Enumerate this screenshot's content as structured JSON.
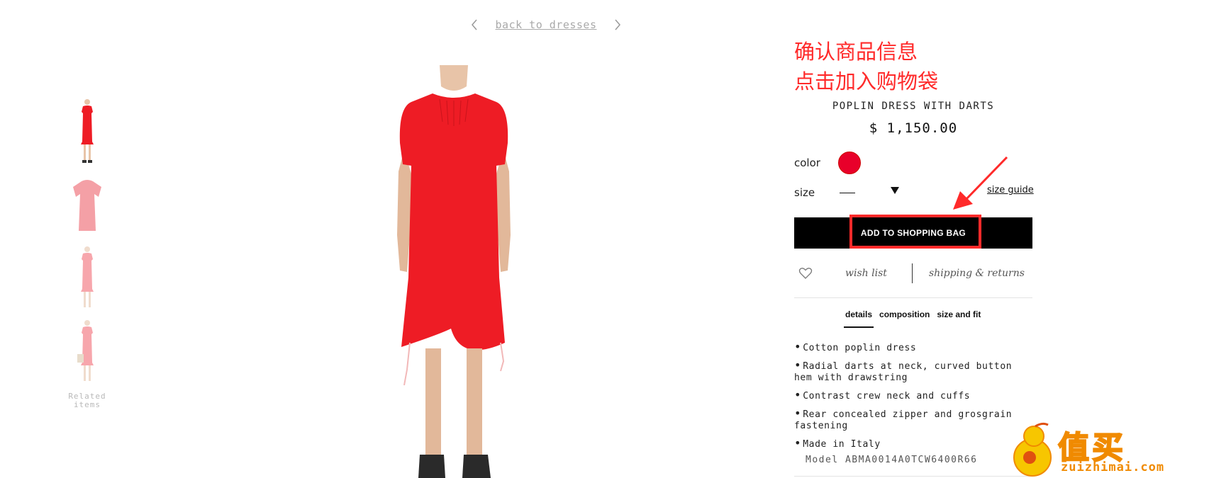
{
  "nav": {
    "back_label": "back to dresses",
    "prev_icon": "chevron-left-icon",
    "next_icon": "chevron-right-icon"
  },
  "gallery": {
    "thumbnails": [
      "front view",
      "flat view",
      "side view",
      "styled view"
    ],
    "related_label_line1": "Related",
    "related_label_line2": "items"
  },
  "annotation": {
    "line1": "确认商品信息",
    "line2": "点击加入购物袋",
    "color": "#ff2a2a"
  },
  "product": {
    "name": "POPLIN DRESS WITH DARTS",
    "price": "$ 1,150.00",
    "color_label": "color",
    "color_value": "#e8002a",
    "size_label": "size",
    "size_value": "——",
    "size_guide": "size guide",
    "add_to_bag": "ADD TO SHOPPING BAG",
    "wish_list": "wish list",
    "shipping": "shipping & returns"
  },
  "tabs": [
    {
      "label": "details",
      "active": true
    },
    {
      "label": "composition",
      "active": false
    },
    {
      "label": "size and fit",
      "active": false
    }
  ],
  "details": [
    "Cotton poplin dress",
    "Radial darts at neck, curved button hem with drawstring",
    "Contrast crew neck and cuffs",
    "Rear concealed zipper and grosgrain fastening",
    "Made in Italy"
  ],
  "model": "Model  ABMA0014A0TCW6400R66",
  "watermark": {
    "text": "值买",
    "url": "zuizhimai.com"
  },
  "colors": {
    "dress": "#ee1c25",
    "accent": "#ff2a2a",
    "button": "#000000"
  }
}
